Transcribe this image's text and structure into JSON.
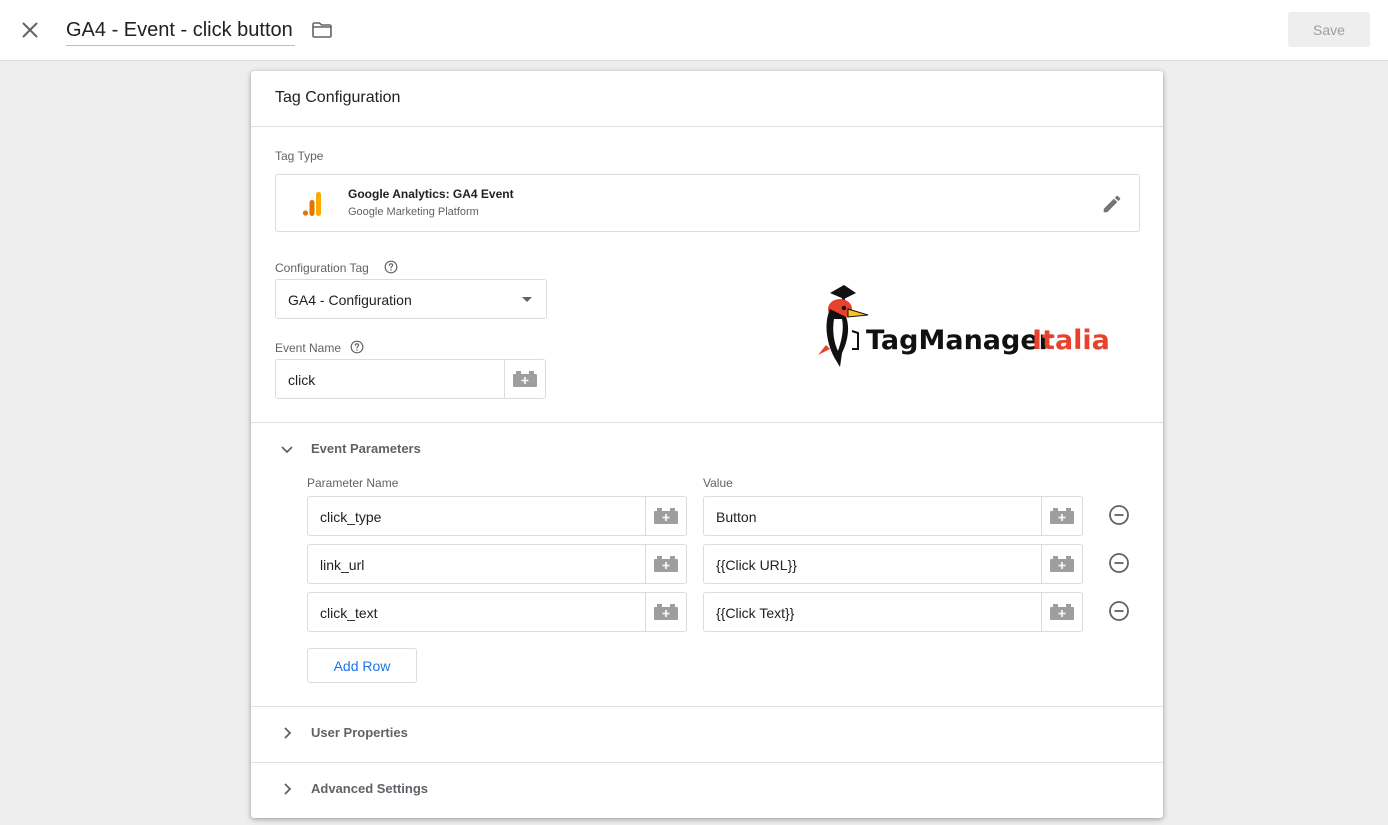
{
  "topbar": {
    "title": "GA4 - Event - click button",
    "save_label": "Save"
  },
  "card": {
    "title": "Tag Configuration",
    "tag_type": {
      "label": "Tag Type",
      "name": "Google Analytics: GA4 Event",
      "provider": "Google Marketing Platform"
    },
    "configuration_tag": {
      "label": "Configuration Tag",
      "value": "GA4 - Configuration"
    },
    "event_name": {
      "label": "Event Name",
      "value": "click"
    },
    "logo": {
      "text_main": "TagManager",
      "text_accent": "Italia"
    },
    "event_parameters": {
      "title": "Event Parameters",
      "col_name": "Parameter Name",
      "col_value": "Value",
      "rows": [
        {
          "name": "click_type",
          "value": "Button"
        },
        {
          "name": "link_url",
          "value": "{{Click URL}}"
        },
        {
          "name": "click_text",
          "value": "{{Click Text}}"
        }
      ],
      "add_row_label": "Add Row"
    },
    "user_properties": {
      "title": "User Properties"
    },
    "advanced_settings": {
      "title": "Advanced Settings"
    }
  },
  "colors": {
    "accent_blue": "#1a73e8",
    "ga_orange": "#f9ab00",
    "ga_dark_orange": "#e37400",
    "logo_red": "#e8412c"
  },
  "icons": [
    "close-icon",
    "folder-icon",
    "ga-icon",
    "edit-icon",
    "help-icon",
    "variable-icon",
    "chevron-down-icon",
    "chevron-right-icon",
    "remove-circle-icon"
  ]
}
